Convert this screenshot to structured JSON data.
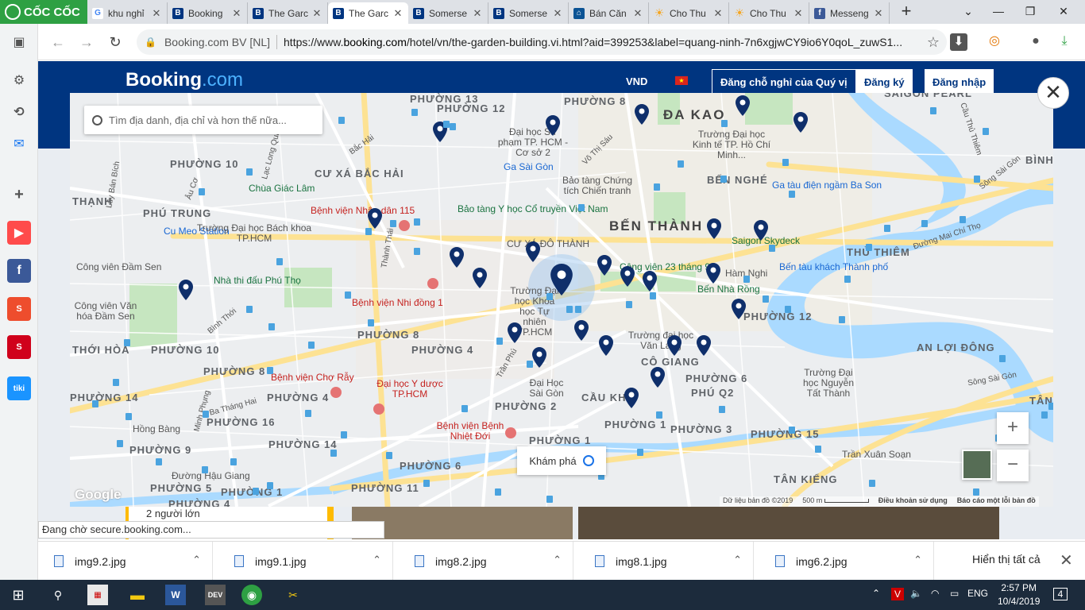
{
  "browser": {
    "brand": "CỐC CỐC",
    "tabs": [
      {
        "title": "khu nghỉ",
        "icon": "google-icon",
        "active": false
      },
      {
        "title": "Booking",
        "icon": "booking-icon",
        "active": false
      },
      {
        "title": "The Garc",
        "icon": "booking-icon",
        "active": false
      },
      {
        "title": "The Garc",
        "icon": "booking-icon",
        "active": true
      },
      {
        "title": "Somerse",
        "icon": "booking-icon",
        "active": false
      },
      {
        "title": "Somerse",
        "icon": "booking-icon",
        "active": false
      },
      {
        "title": "Bán Căn",
        "icon": "home-icon",
        "active": false
      },
      {
        "title": "Cho Thu",
        "icon": "sun-icon",
        "active": false
      },
      {
        "title": "Cho Thu",
        "icon": "sun-icon",
        "active": false
      },
      {
        "title": "Messeng",
        "icon": "facebook-icon",
        "active": false
      }
    ],
    "url_owner": "Booking.com BV [NL]",
    "url_prefix": "https://www.",
    "url_domain": "booking.com",
    "url_rest": "/hotel/vn/the-garden-building.vi.html?aid=399253&label=quang-ninh-7n6xgjwCY9io6Y0qoL_zuwS1..."
  },
  "booking": {
    "logo_main": "Booking",
    "logo_suffix": ".com",
    "currency": "VND",
    "list_property": "Đăng chỗ nghỉ của Quý vị",
    "register": "Đăng ký",
    "login": "Đăng nhập",
    "guests": "2 người lớn",
    "colors": {
      "brand": "#003580",
      "accent": "#febb02",
      "pin": "#0f2f6b"
    }
  },
  "map": {
    "search_placeholder": "Tìm địa danh, địa chỉ và hơn thế nữa...",
    "explore_label": "Khám phá",
    "zoom_in": "+",
    "zoom_out": "−",
    "google": "Google",
    "attribution": "Dữ liệu bản đồ ©2019",
    "scale": "500 m",
    "terms": "Điều khoản sử dụng",
    "report": "Báo cáo một lỗi bản đồ",
    "labels": {
      "p13": "PHƯỜNG 13",
      "p12a": "PHƯỜNG 12",
      "p8a": "PHƯỜNG 8",
      "dakao": "ĐA KAO",
      "saigonpearl": "SAIGON PEARL",
      "p10a": "PHƯỜNG 10",
      "cuxa": "CƯ XÁ BẮC HẢI",
      "chuagiaclam": "Chùa Giác Lâm",
      "thanh": "THẠNH",
      "phutrung": "PHÚ TRUNG",
      "cumeo": "Cu Meo Station",
      "bv115": "Bệnh viện Nhân dân 115",
      "btyhoc": "Bảo tàng Y học Cổ truyền Việt Nam",
      "dhbk": "Trường Đại học Bách khoa TP.HCM",
      "dhsp": "Đại học Sư phạm TP. HCM - Cơ sở 2",
      "gasaigon": "Ga Sài Gòn",
      "vothisau": "Võ Thị Sáu",
      "btct": "Bảo tàng Chứng tích Chiến tranh",
      "dhkt": "Trường Đại học Kinh tế TP. Hồ Chí Minh...",
      "bennghe": "BẾN NGHÉ",
      "gadien": "Ga tàu điện ngầm Ba Son",
      "binhkh": "BÌNH KH",
      "songsaigon1": "Sông Sài Gòn",
      "caucaosu": "Cầu Thủ Thiêm",
      "benthanh": "BẾN THÀNH",
      "cuxado": "CƯ XÁ ĐÔ THÀNH",
      "congvien23": "Công viên 23 tháng 9",
      "hamnghi": "Hàm Nghi",
      "skydeck": "Saigon Skydeck",
      "bentau": "Bến tàu khách Thành phố",
      "thuthiem": "THỦ THIÊM",
      "maichitho": "Đường Mai Chí Thọ",
      "damsen": "Công viên Đầm Sen",
      "ntdpt": "Nhà thi đấu Phú Thọ",
      "dhkhtn": "Trường Đại học Khoa học Tự nhiên TP.HCM",
      "bennharong": "Bến Nhà Rồng",
      "p12b": "PHƯỜNG 12",
      "cvvh": "Công viên Văn hóa Đầm Sen",
      "binhthoi": "Bình Thới",
      "bvnd1": "Bệnh viện Nhi đồng 1",
      "p8b": "PHƯỜNG 8",
      "p4a": "PHƯỜNG 4",
      "nguyencutrinh": "NGUYỄN CƯ TRINH",
      "dhvl": "Trường đại học Văn Lang",
      "anloidong": "AN LỢI ĐÔNG",
      "thoihoa": "THỚI HÒA",
      "p10b": "PHƯỜNG 10",
      "p8c": "PHƯỜNG 8",
      "bvchoray": "Bệnh viện Chợ Rẫy",
      "dhyd": "Đại học Y dược TP.HCM",
      "dhsg": "Đại Học Sài Gòn",
      "cogiang": "CÔ GIANG",
      "p6": "PHƯỜNG 6",
      "phuq2": "PHÚ Q2",
      "dhntt": "Trường Đại học Nguyễn Tất Thành",
      "songsaigon2": "Sông Sài Gòn",
      "p14a": "PHƯỜNG 14",
      "minhphung": "Minh Phụng",
      "bathanghai": "Ba Tháng Hai",
      "p4b": "PHƯỜNG 4",
      "caukho": "CẦU KHO",
      "tanphu": "TÂN",
      "p16": "PHƯỜNG 16",
      "p2": "PHƯỜNG 2",
      "p1a": "PHƯỜNG 1",
      "p3": "PHƯỜNG 3",
      "p15": "PHƯỜNG 15",
      "hongbang": "Hồng Bàng",
      "p14b": "PHƯỜNG 14",
      "bvnhietdoi": "Bệnh viện Bệnh Nhiệt Đới",
      "p9": "PHƯỜNG 9",
      "p1b": "PHƯỜNG 1",
      "tranxuanson": "Trần Xuân Soạn",
      "dhg": "Đường Hậu Giang",
      "p6b": "PHƯỜNG 6",
      "p5": "PHƯỜNG 5",
      "p11": "PHƯỜNG 11",
      "tankieng": "TÂN KIỂNG",
      "p4c": "PHƯỜNG 4",
      "p1c": "PHƯỜNG 1",
      "luybanbich": "Lũy Bán Bích",
      "aucо": "Âu Cơ",
      "lacLongQuan": "Lạc Long Quân",
      "bachai": "Bắc Hải",
      "thanhthai": "Thành Thái",
      "tranphu": "Trần Phú",
      "cudamsen": "Cư xá Đầm Sen"
    }
  },
  "status": "Đang chờ secure.booking.com...",
  "downloads": {
    "items": [
      "img9.2.jpg",
      "img9.1.jpg",
      "img8.2.jpg",
      "img8.1.jpg",
      "img6.2.jpg"
    ],
    "show_all": "Hiển thị tất cả"
  },
  "taskbar": {
    "lang": "ENG",
    "time": "2:57 PM",
    "date": "10/4/2019",
    "notif": "4"
  }
}
